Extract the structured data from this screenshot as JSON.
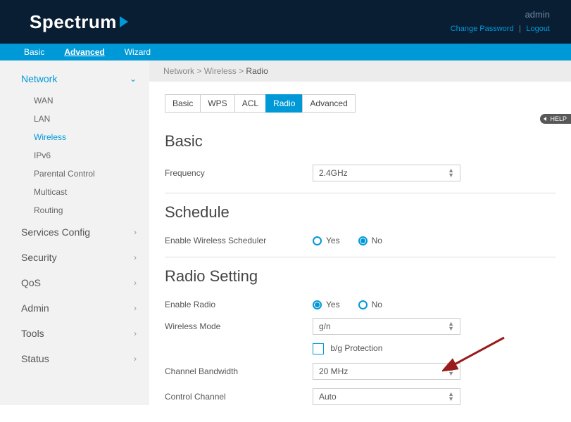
{
  "header": {
    "logo_text": "Spectrum",
    "user": "admin",
    "change_password": "Change Password",
    "logout": "Logout"
  },
  "topnav": {
    "items": [
      "Basic",
      "Advanced",
      "Wizard"
    ],
    "active_index": 1
  },
  "sidebar": {
    "network": {
      "label": "Network",
      "items": [
        "WAN",
        "LAN",
        "Wireless",
        "IPv6",
        "Parental Control",
        "Multicast",
        "Routing"
      ],
      "active_index": 2
    },
    "groups": [
      {
        "label": "Services Config"
      },
      {
        "label": "Security"
      },
      {
        "label": "QoS"
      },
      {
        "label": "Admin"
      },
      {
        "label": "Tools"
      },
      {
        "label": "Status"
      }
    ]
  },
  "breadcrumb": {
    "parts": [
      "Network",
      "Wireless"
    ],
    "current": "Radio"
  },
  "tabs": {
    "items": [
      "Basic",
      "WPS",
      "ACL",
      "Radio",
      "Advanced"
    ],
    "active_index": 3
  },
  "sections": {
    "basic": {
      "title": "Basic",
      "frequency_label": "Frequency",
      "frequency_value": "2.4GHz"
    },
    "schedule": {
      "title": "Schedule",
      "enable_label": "Enable Wireless Scheduler",
      "yes": "Yes",
      "no": "No",
      "value": "No"
    },
    "radio": {
      "title": "Radio Setting",
      "enable_label": "Enable Radio",
      "enable_value": "Yes",
      "yes": "Yes",
      "no": "No",
      "mode_label": "Wireless Mode",
      "mode_value": "g/n",
      "bg_protection": "b/g Protection",
      "bandwidth_label": "Channel Bandwidth",
      "bandwidth_value": "20 MHz",
      "channel_label": "Control Channel",
      "channel_value": "Auto"
    }
  },
  "help": "HELP"
}
